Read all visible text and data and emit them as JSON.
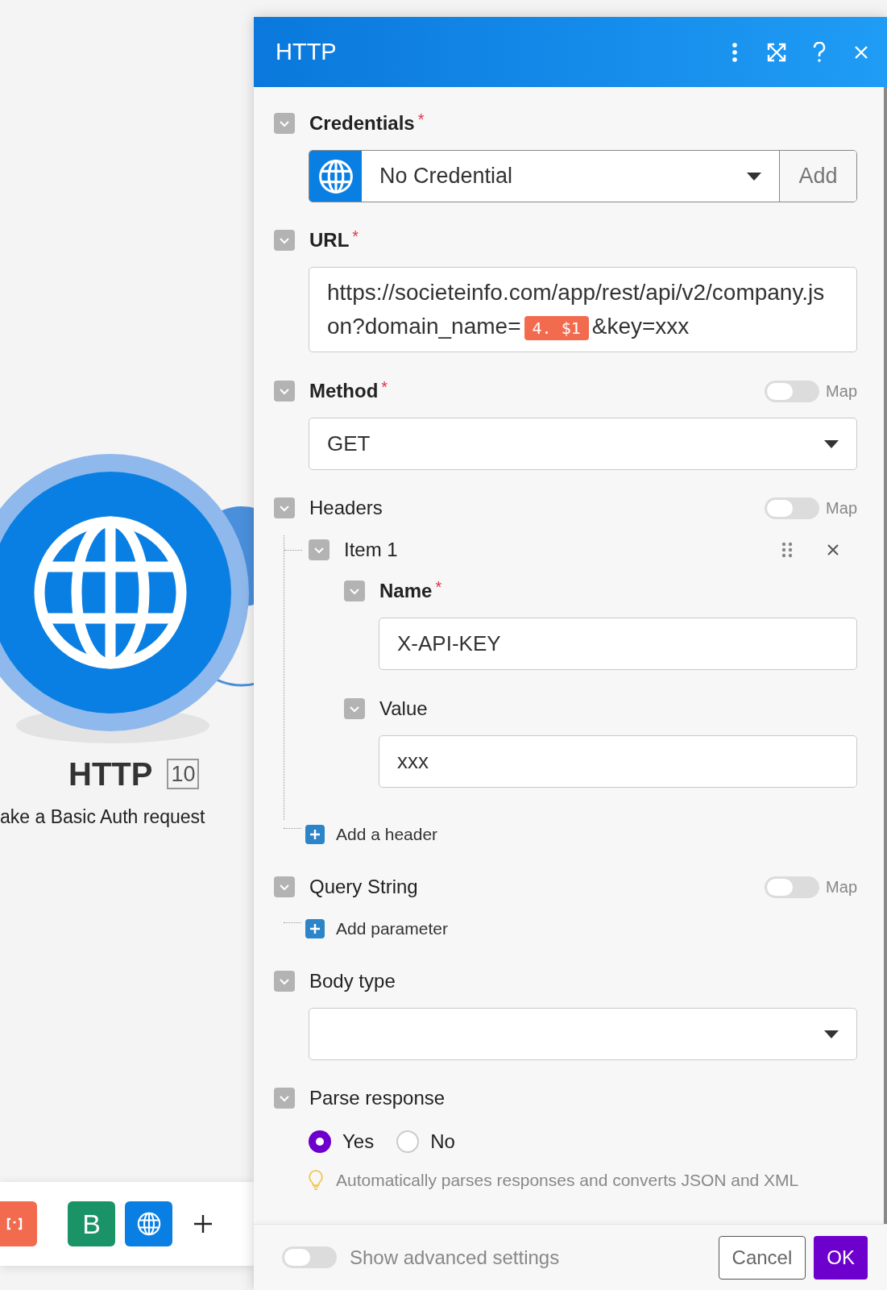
{
  "canvas": {
    "module": {
      "title": "HTTP",
      "badge": "10",
      "subtitle": "ake a Basic Auth request"
    },
    "toolbar": [
      {
        "kind": "bracket",
        "color": "#f26b4f"
      },
      {
        "kind": "letter",
        "label": "B",
        "color": "#1a9467"
      },
      {
        "kind": "globe",
        "color": "#0a7fe3"
      },
      {
        "kind": "add"
      }
    ]
  },
  "dialog": {
    "title": "HTTP",
    "fields": [
      {
        "kind": "credential",
        "label": "Credentials",
        "required_mark": "*",
        "value": "No Credential",
        "button": "Add"
      },
      {
        "kind": "url",
        "label": "URL",
        "required_mark": "*",
        "parts": [
          {
            "kind": "text",
            "text": "https://societeinfo.com/app/rest/api/v2/company.json?domain_name="
          },
          {
            "kind": "token",
            "text": "4. $1"
          },
          {
            "kind": "text",
            "text": "&key=xxx"
          }
        ]
      },
      {
        "kind": "select",
        "label": "Method",
        "required_mark": "*",
        "map": false,
        "map_label": "Map",
        "value": "GET"
      },
      {
        "kind": "array",
        "label": "Headers",
        "map": false,
        "map_label": "Map",
        "items": [
          {
            "label": "Item 1",
            "fields": [
              {
                "label": "Name",
                "required_mark": "*",
                "value": "X-API-KEY"
              },
              {
                "label": "Value",
                "value": "xxx"
              }
            ]
          }
        ],
        "add": "Add a header"
      },
      {
        "kind": "array",
        "label": "Query String",
        "map": false,
        "map_label": "Map",
        "add": "Add parameter"
      },
      {
        "kind": "select",
        "label": "Body type"
      },
      {
        "kind": "radio",
        "label": "Parse response",
        "options": [
          {
            "label": "Yes",
            "selected": true
          },
          {
            "label": "No",
            "selected": false
          }
        ],
        "hint": "Automatically parses responses and converts JSON and XML"
      }
    ],
    "footer": {
      "advanced": {
        "label": "Show advanced settings",
        "on": false
      },
      "cancel": "Cancel",
      "ok": "OK"
    }
  }
}
